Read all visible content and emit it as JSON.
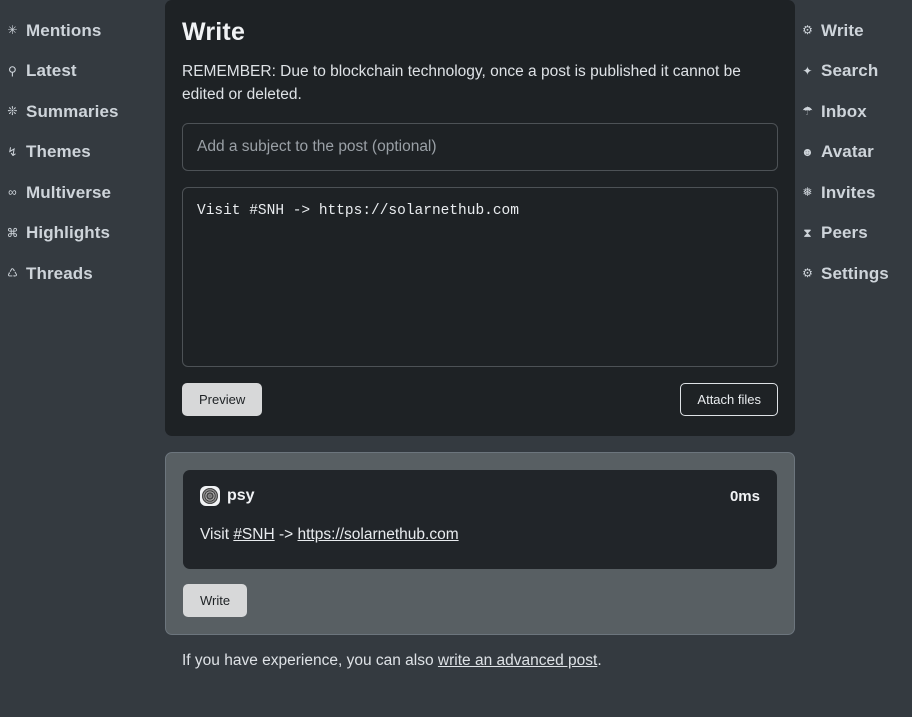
{
  "nav_left": {
    "items": [
      {
        "icon": "sun-burst-icon",
        "glyph": "✳",
        "label": "Mentions"
      },
      {
        "icon": "mars-stroke-icon",
        "glyph": "⚲",
        "label": "Latest"
      },
      {
        "icon": "snowflake-icon",
        "glyph": "❊",
        "label": "Summaries"
      },
      {
        "icon": "lightning-bolt-icon",
        "glyph": "↯",
        "label": "Themes"
      },
      {
        "icon": "infinity-icon",
        "glyph": "∞",
        "label": "Multiverse"
      },
      {
        "icon": "command-icon",
        "glyph": "⌘",
        "label": "Highlights"
      },
      {
        "icon": "recycle-triangle-icon",
        "glyph": "♺",
        "label": "Threads"
      }
    ]
  },
  "nav_right": {
    "items": [
      {
        "icon": "gear-circle-icon",
        "glyph": "⚙",
        "label": "Write"
      },
      {
        "icon": "sparkle-star-icon",
        "glyph": "✦",
        "label": "Search"
      },
      {
        "icon": "umbrella-icon",
        "glyph": "☂",
        "label": "Inbox"
      },
      {
        "icon": "face-circle-icon",
        "glyph": "☻",
        "label": "Avatar"
      },
      {
        "icon": "snowflake-icon",
        "glyph": "❅",
        "label": "Invites"
      },
      {
        "icon": "hourglass-icon",
        "glyph": "⧗",
        "label": "Peers"
      },
      {
        "icon": "gear-icon",
        "glyph": "⚙",
        "label": "Settings"
      }
    ]
  },
  "write": {
    "title": "Write",
    "remember_notice": "REMEMBER: Due to blockchain technology, once a post is published it cannot be edited or deleted.",
    "subject_placeholder": "Add a subject to the post (optional)",
    "subject_value": "",
    "body_value": "Visit #SNH -> https://solarnethub.com",
    "preview_button": "Preview",
    "attach_button": "Attach files"
  },
  "preview": {
    "author": "psy",
    "timestamp": "0ms",
    "post_text_prefix": "Visit ",
    "post_tag": "#SNH",
    "post_arrow": " -> ",
    "post_link": "https://solarnethub.com",
    "write_button": "Write"
  },
  "footer": {
    "text_before": "If you have experience, you can also ",
    "link_text": "write an advanced post",
    "text_after": "."
  },
  "colors": {
    "page_background": "#343a40",
    "card_background": "#1e2225",
    "preview_outer": "#585f63",
    "post_background": "#212529",
    "button_light": "#d7d8d9",
    "text_primary": "#dee2e6"
  }
}
